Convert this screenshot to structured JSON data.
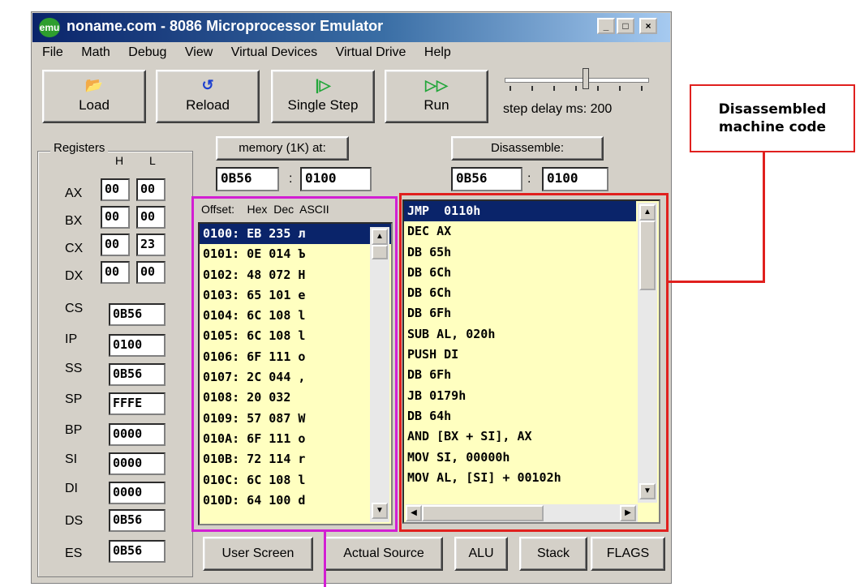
{
  "window": {
    "title": "noname.com - 8086 Microprocessor Emulator",
    "controls": [
      "_",
      "□",
      "×"
    ]
  },
  "menu": [
    "File",
    "Math",
    "Debug",
    "View",
    "Virtual Devices",
    "Virtual Drive",
    "Help"
  ],
  "toolbar": {
    "load": "Load",
    "reload": "Reload",
    "single_step": "Single Step",
    "run": "Run",
    "step_delay": "step delay ms: 200"
  },
  "registers": {
    "title": "Registers",
    "h_label": "H",
    "l_label": "L",
    "general": [
      {
        "name": "AX",
        "h": "00",
        "l": "00"
      },
      {
        "name": "BX",
        "h": "00",
        "l": "00"
      },
      {
        "name": "CX",
        "h": "00",
        "l": "23"
      },
      {
        "name": "DX",
        "h": "00",
        "l": "00"
      }
    ],
    "segment": [
      {
        "name": "CS",
        "value": "0B56"
      },
      {
        "name": "IP",
        "value": "0100"
      },
      {
        "name": "SS",
        "value": "0B56"
      },
      {
        "name": "SP",
        "value": "FFFE"
      },
      {
        "name": "BP",
        "value": "0000"
      },
      {
        "name": "SI",
        "value": "0000"
      },
      {
        "name": "DI",
        "value": "0000"
      },
      {
        "name": "DS",
        "value": "0B56"
      },
      {
        "name": "ES",
        "value": "0B56"
      }
    ]
  },
  "memory": {
    "button": "memory (1K) at:",
    "segment": "0B56",
    "offset": "0100",
    "separator": ":",
    "header": "Offset:    Hex  Dec  ASCII",
    "rows": [
      "0100: EB 235 л",
      "0101: 0E 014 Ъ",
      "0102: 48 072 H",
      "0103: 65 101 e",
      "0104: 6C 108 l",
      "0105: 6C 108 l",
      "0106: 6F 111 o",
      "0107: 2C 044 ,",
      "0108: 20 032",
      "0109: 57 087 W",
      "010A: 6F 111 o",
      "010B: 72 114 r",
      "010C: 6C 108 l",
      "010D: 64 100 d"
    ]
  },
  "disassembly": {
    "button": "Disassemble:",
    "segment": "0B56",
    "offset": "0100",
    "separator": ":",
    "rows": [
      "JMP  0110h",
      "DEC AX",
      "DB 65h",
      "DB 6Ch",
      "DB 6Ch",
      "DB 6Fh",
      "SUB AL, 020h",
      "PUSH DI",
      "DB 6Fh",
      "JB 0179h",
      "DB 64h",
      "AND [BX + SI], AX",
      "MOV SI, 00000h",
      "MOV AL, [SI] + 00102h"
    ]
  },
  "bottom_buttons": [
    "User Screen",
    "Actual Source",
    "ALU",
    "Stack",
    "FLAGS"
  ],
  "callout": {
    "text_line1": "Disassembled",
    "text_line2": "machine code"
  },
  "colors": {
    "titlebar": "#0a246a",
    "list_bg": "#ffffc0",
    "selection": "#0a246a",
    "magenta_frame": "#d21fd2",
    "red_frame": "#e0201e"
  }
}
